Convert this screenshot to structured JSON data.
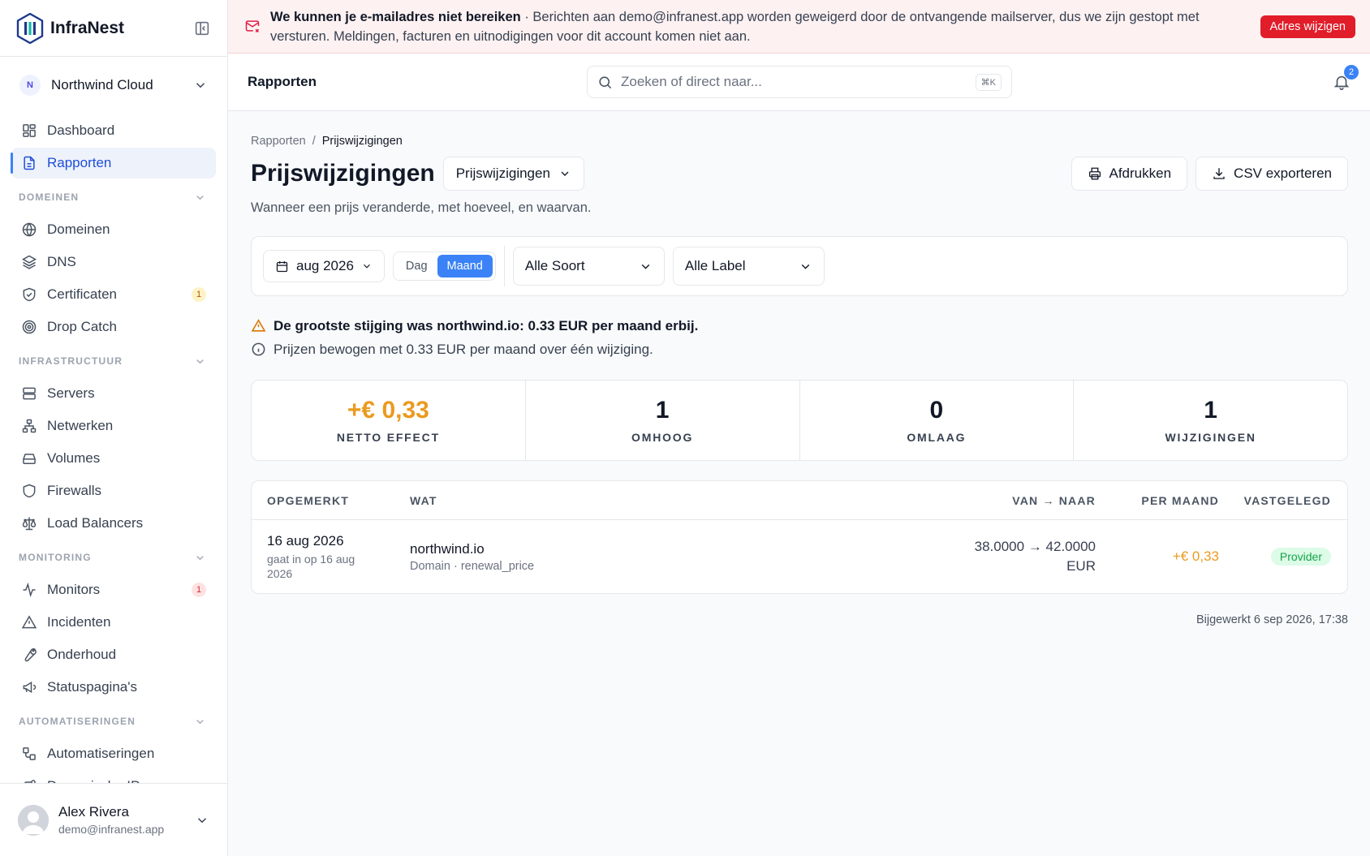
{
  "sidebar": {
    "brand": "InfraNest",
    "org": {
      "initial": "N",
      "name": "Northwind Cloud"
    },
    "top_items": [
      {
        "label": "Dashboard",
        "icon": "dashboard-icon"
      },
      {
        "label": "Rapporten",
        "icon": "document-icon",
        "active": true
      }
    ],
    "sections": [
      {
        "title": "DOMEINEN",
        "items": [
          {
            "label": "Domeinen",
            "icon": "globe-icon"
          },
          {
            "label": "DNS",
            "icon": "layers-icon"
          },
          {
            "label": "Certificaten",
            "icon": "shield-check-icon",
            "badge": "1"
          },
          {
            "label": "Drop Catch",
            "icon": "target-icon"
          }
        ]
      },
      {
        "title": "INFRASTRUCTUUR",
        "items": [
          {
            "label": "Servers",
            "icon": "server-icon"
          },
          {
            "label": "Netwerken",
            "icon": "network-icon"
          },
          {
            "label": "Volumes",
            "icon": "drive-icon"
          },
          {
            "label": "Firewalls",
            "icon": "shield-icon"
          },
          {
            "label": "Load Balancers",
            "icon": "scale-icon"
          }
        ]
      },
      {
        "title": "MONITORING",
        "items": [
          {
            "label": "Monitors",
            "icon": "activity-icon",
            "badge": "1"
          },
          {
            "label": "Incidenten",
            "icon": "alert-triangle-icon"
          },
          {
            "label": "Onderhoud",
            "icon": "wrench-icon"
          },
          {
            "label": "Statuspagina's",
            "icon": "megaphone-icon"
          }
        ]
      },
      {
        "title": "AUTOMATISERINGEN",
        "items": [
          {
            "label": "Automatiseringen",
            "icon": "workflow-icon"
          },
          {
            "label": "Dynamische IPs",
            "icon": "route-icon"
          }
        ]
      }
    ],
    "user": {
      "name": "Alex Rivera",
      "email": "demo@infranest.app"
    }
  },
  "banner": {
    "title": "We kunnen je e-mailadres niet bereiken",
    "message": " · Berichten aan demo@infranest.app worden geweigerd door de ontvangende mailserver, dus we zijn gestopt met versturen. Meldingen, facturen en uitnodigingen voor dit account komen niet aan.",
    "button": "Adres wijzigen"
  },
  "topbar": {
    "title": "Rapporten",
    "search_placeholder": "Zoeken of direct naar...",
    "shortcut": "⌘K",
    "notifications": "2"
  },
  "page": {
    "breadcrumb": [
      "Rapporten",
      "Prijswijzigingen"
    ],
    "breadcrumb_sep": "/",
    "title": "Prijswijzigingen",
    "report_select": "Prijswijzigingen",
    "print": "Afdrukken",
    "export": "CSV exporteren",
    "subtitle": "Wanneer een prijs veranderde, met hoeveel, en waarvan."
  },
  "filters": {
    "month": "aug 2026",
    "period_options": [
      "Dag",
      "Maand"
    ],
    "period_selected": "Maand",
    "type": "Alle Soort",
    "label": "Alle Label"
  },
  "notes": {
    "warning": "De grootste stijging was northwind.io: 0.33 EUR per maand erbij.",
    "info": "Prijzen bewogen met 0.33 EUR per maand over één wijziging."
  },
  "stats": [
    {
      "value": "+€ 0,33",
      "label": "NETTO EFFECT",
      "positive": true
    },
    {
      "value": "1",
      "label": "OMHOOG"
    },
    {
      "value": "0",
      "label": "OMLAAG"
    },
    {
      "value": "1",
      "label": "WIJZIGINGEN"
    }
  ],
  "table": {
    "headers": [
      "OPGEMERKT",
      "WAT",
      "VAN → NAAR",
      "PER MAAND",
      "VASTGELEGD"
    ],
    "rows": [
      {
        "date": "16 aug 2026",
        "date_sub": "gaat in op 16 aug 2026",
        "what": "northwind.io",
        "what_sub": "Domain · renewal_price",
        "from_to": "38.0000 → 42.0000",
        "currency": "EUR",
        "per_month": "+€ 0,33",
        "source": "Provider"
      }
    ]
  },
  "updated": "Bijgewerkt 6 sep 2026, 17:38",
  "colors": {
    "accent": "#3b82f6",
    "positive": "#eb9a1f",
    "danger": "#e11d2a",
    "success": "#16a34a"
  }
}
